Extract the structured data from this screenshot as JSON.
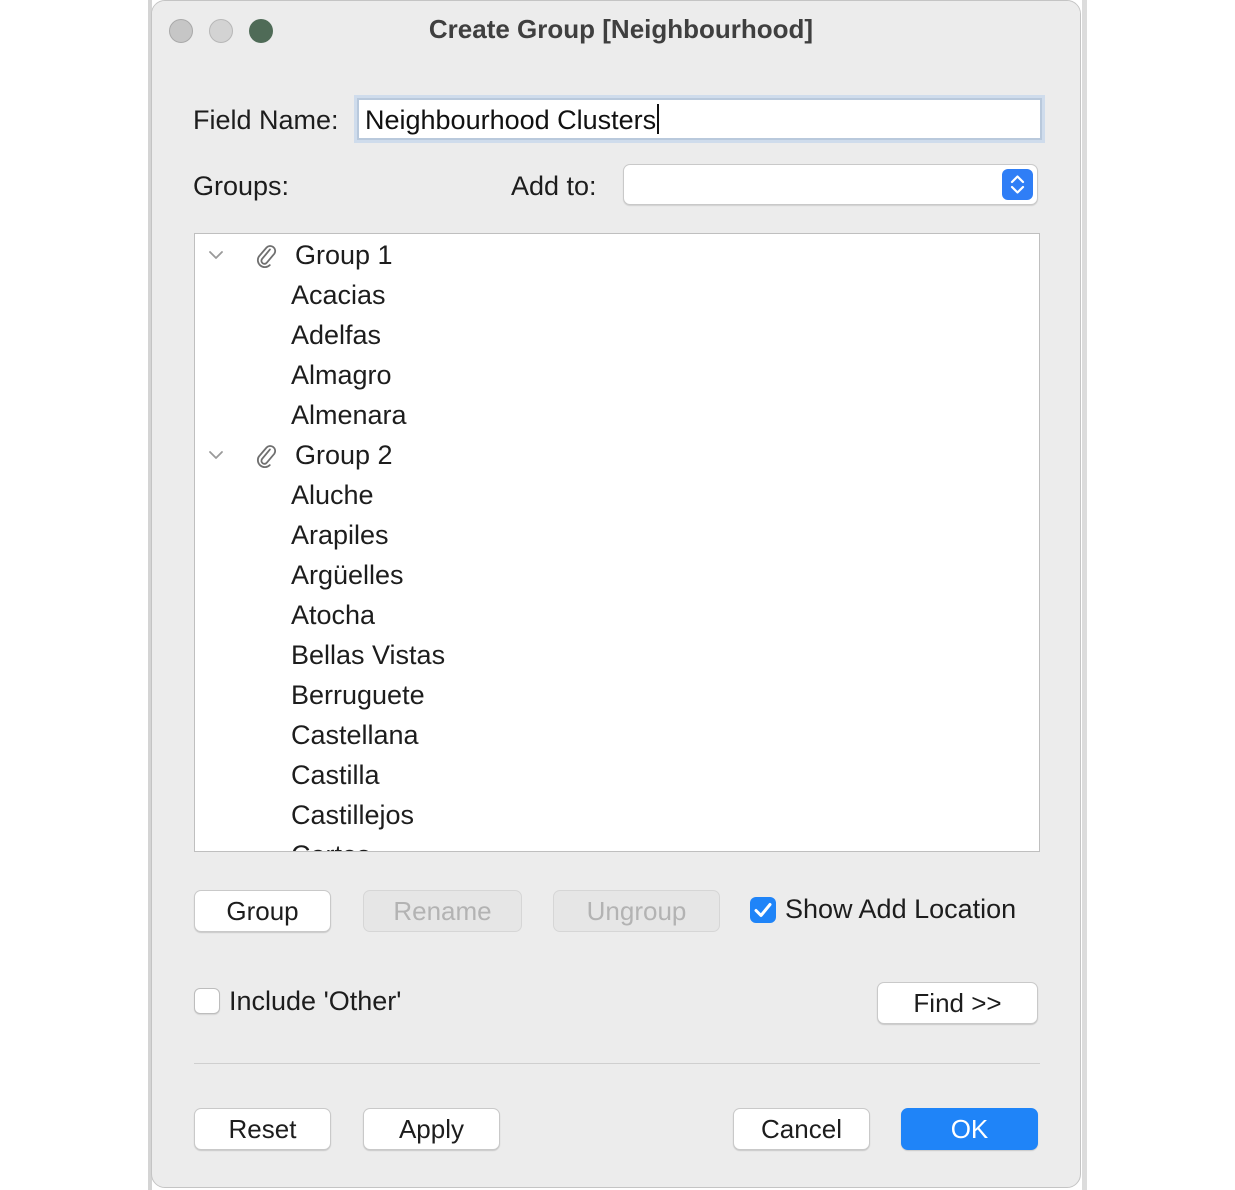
{
  "window": {
    "title": "Create Group [Neighbourhood]"
  },
  "field": {
    "label": "Field Name:",
    "value": "Neighbourhood Clusters"
  },
  "groups_label": "Groups:",
  "add_to": {
    "label": "Add to:",
    "value": ""
  },
  "tree": {
    "groups": [
      {
        "name": "Group 1",
        "icon": "paperclip-icon",
        "items": [
          "Acacias",
          "Adelfas",
          "Almagro",
          "Almenara"
        ]
      },
      {
        "name": "Group 2",
        "icon": "paperclip-icon",
        "items": [
          "Aluche",
          "Arapiles",
          "Argüelles",
          "Atocha",
          "Bellas Vistas",
          "Berruguete",
          "Castellana",
          "Castilla",
          "Castillejos",
          "Cortes"
        ]
      }
    ]
  },
  "buttons": {
    "group": "Group",
    "rename": "Rename",
    "ungroup": "Ungroup",
    "find": "Find >>",
    "reset": "Reset",
    "apply": "Apply",
    "cancel": "Cancel",
    "ok": "OK"
  },
  "options": {
    "show_add_location": {
      "label": "Show Add Location",
      "checked": true
    },
    "include_other": {
      "label": "Include 'Other'",
      "checked": false
    }
  },
  "colors": {
    "accent": "#1f84f8",
    "window_bg": "#ececec"
  }
}
